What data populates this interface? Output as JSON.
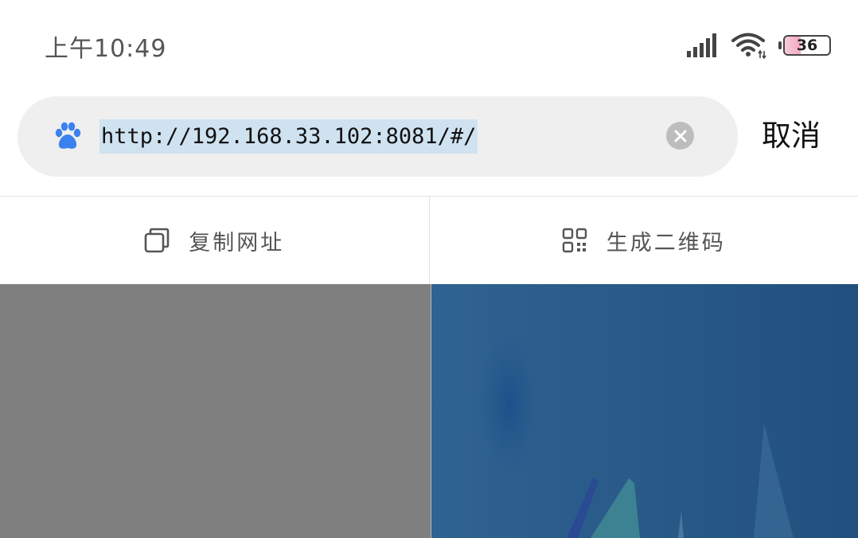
{
  "status_bar": {
    "time": "上午10:49",
    "battery_level": "36"
  },
  "search": {
    "url": "http://192.168.33.102:8081/#/",
    "engine_icon": "baidu-paw-icon",
    "clear_icon": "clear-icon",
    "cancel_label": "取消"
  },
  "actions": {
    "copy_label": "复制网址",
    "copy_icon": "copy-icon",
    "qr_label": "生成二维码",
    "qr_icon": "qr-code-icon"
  },
  "colors": {
    "search_bg": "#efefef",
    "url_highlight": "#cfe2f0",
    "paw_blue": "#3b82f0",
    "left_panel": "#7f7f7f",
    "right_panel": "#265a88"
  }
}
